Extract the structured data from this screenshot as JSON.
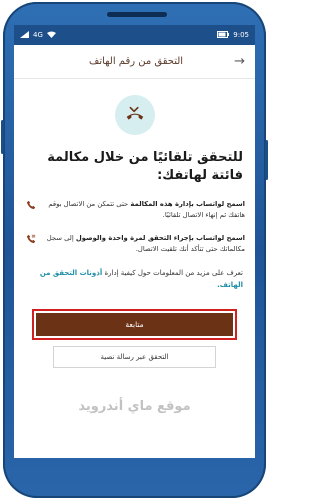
{
  "status_bar": {
    "time": "9:05",
    "signal_text": "4G"
  },
  "app_bar": {
    "title": "التحقق من رقم الهاتف"
  },
  "headline": "للتحقق تلقائيًا من خلال مكالمة فائتة لهاتفك:",
  "info": [
    {
      "bold": "اسمح لواتساب بإدارة هذه المكالمة",
      "text": " حتى تتمكن من الاتصال بوقم هاتفك ثم إنهاء الاتصال تلقائيًا.",
      "icon": "phone-end-icon"
    },
    {
      "bold": "اسمح لواتساب بإجراء التحقق لمرة واحدة والوصول",
      "text": " إلى سجل مكالماتك حتى تتأكد أنك تلقيت الاتصال.",
      "icon": "call-log-icon"
    }
  ],
  "learn_more": {
    "text": "تعرف على مزيد من المعلومات حول كيفية إدارة ",
    "link": "أذونات التحقق من الهاتف."
  },
  "buttons": {
    "continue": "متابعة",
    "sms": "التحقق عبر رسالة نصية"
  },
  "watermark": "موقع ماي أندرويد",
  "colors": {
    "brand_brown": "#6b3216",
    "highlight_red": "#d21f1f",
    "link_teal": "#1f8fa8",
    "hero_bg": "#d6eef0",
    "status_bar": "#1d4f8a"
  }
}
